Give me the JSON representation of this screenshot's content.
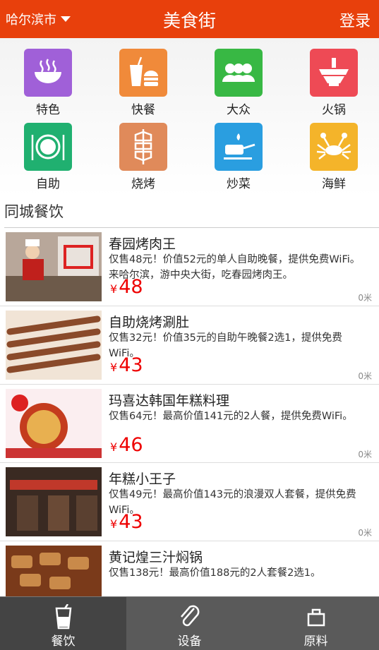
{
  "header": {
    "city": "哈尔滨市",
    "title": "美食街",
    "login": "登录"
  },
  "categories": [
    {
      "label": "特色",
      "color": "#a060d8",
      "icon": "bowl-icon"
    },
    {
      "label": "快餐",
      "color": "#f08a3a",
      "icon": "fastfood-icon"
    },
    {
      "label": "大众",
      "color": "#38b844",
      "icon": "group-icon"
    },
    {
      "label": "火锅",
      "color": "#ee4a55",
      "icon": "hotpot-icon"
    },
    {
      "label": "自助",
      "color": "#20b070",
      "icon": "plate-icon"
    },
    {
      "label": "烧烤",
      "color": "#e08a5a",
      "icon": "skewer-icon"
    },
    {
      "label": "炒菜",
      "color": "#2a9ee0",
      "icon": "pan-icon"
    },
    {
      "label": "海鲜",
      "color": "#f4b42a",
      "icon": "crab-icon"
    }
  ],
  "section_title": "同城餐饮",
  "restaurants": [
    {
      "name": "春园烤肉王",
      "desc": "仅售48元！价值52元的单人自助晚餐，提供免费WiFi。来哈尔滨，游中央大街，吃春园烤肉王。",
      "currency": "¥",
      "price": "48",
      "distance": "0米"
    },
    {
      "name": "自助烧烤涮肚",
      "desc": "仅售32元！价值35元的自助午晚餐2选1，提供免费WiFi。",
      "currency": "¥",
      "price": "43",
      "distance": "0米"
    },
    {
      "name": "玛喜达韩国年糕料理",
      "desc": "仅售64元！最高价值141元的2人餐，提供免费WiFi。",
      "currency": "¥",
      "price": "46",
      "distance": "0米"
    },
    {
      "name": "年糕小王子",
      "desc": "仅售49元！最高价值143元的浪漫双人套餐，提供免费WiFi。",
      "currency": "¥",
      "price": "43",
      "distance": "0米"
    },
    {
      "name": "黄记煌三汁焖锅",
      "desc": "仅售138元！最高价值188元的2人套餐2选1。",
      "currency": "¥",
      "price": "",
      "distance": ""
    }
  ],
  "tabs": [
    {
      "label": "餐饮",
      "icon": "cup-icon"
    },
    {
      "label": "设备",
      "icon": "paperclip-icon"
    },
    {
      "label": "原料",
      "icon": "box-icon"
    }
  ],
  "colors": {
    "brand": "#e8400c",
    "price": "#ee0000",
    "tabbar": "#5a5a5a"
  }
}
